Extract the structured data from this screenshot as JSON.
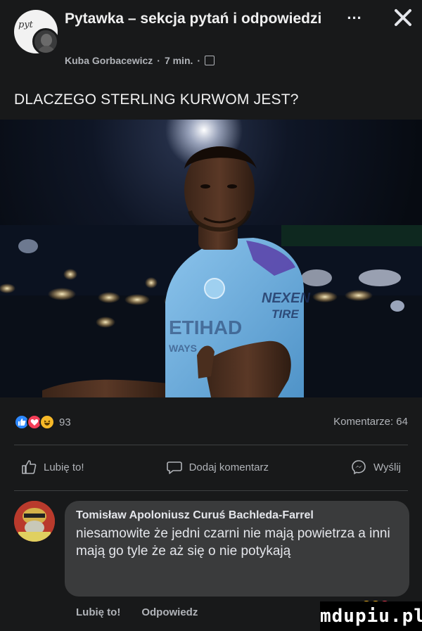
{
  "header": {
    "group_title": "Pytawka – sekcja pytań i odpowiedzi",
    "avatar_scribble": "pyt",
    "author": "Kuba Gorbacewicz",
    "separator": "·",
    "time": "7 min.",
    "more_label": "...",
    "close_icon": "close-icon",
    "privacy_icon": "globe-icon"
  },
  "post": {
    "text": "DLACZEGO STERLING KURWOM JEST?",
    "photo_texts": {
      "badge_sponsor": "NEXEN",
      "badge_sub": "TIRE",
      "shirt_text": "ETIHAD",
      "shirt_sub": "WAYS"
    }
  },
  "stats": {
    "reaction_count": "93",
    "comments_label": "Komentarze: 64",
    "reactions": [
      "like-icon",
      "love-icon",
      "haha-icon"
    ]
  },
  "actions": {
    "like": "Lubię to!",
    "comment": "Dodaj komentarz",
    "share": "Wyślij"
  },
  "comment": {
    "author": "Tomisław Apoloniusz Curuś Bachleda-Farrel",
    "text": "niesamowite że jedni czarni nie mają powietrza a inni mają go tyle że aż się o nie potykają",
    "like_label": "Lubię to!",
    "reply_label": "Odpowiedz"
  },
  "watermark": "mdupiu.pl",
  "colors": {
    "background": "#18191a",
    "bubble": "#3a3b3c",
    "like_blue": "#2d88ff",
    "love_red": "#f33e58",
    "haha_yellow": "#f7b928",
    "jersey_sky_blue": "#6cabdd"
  }
}
